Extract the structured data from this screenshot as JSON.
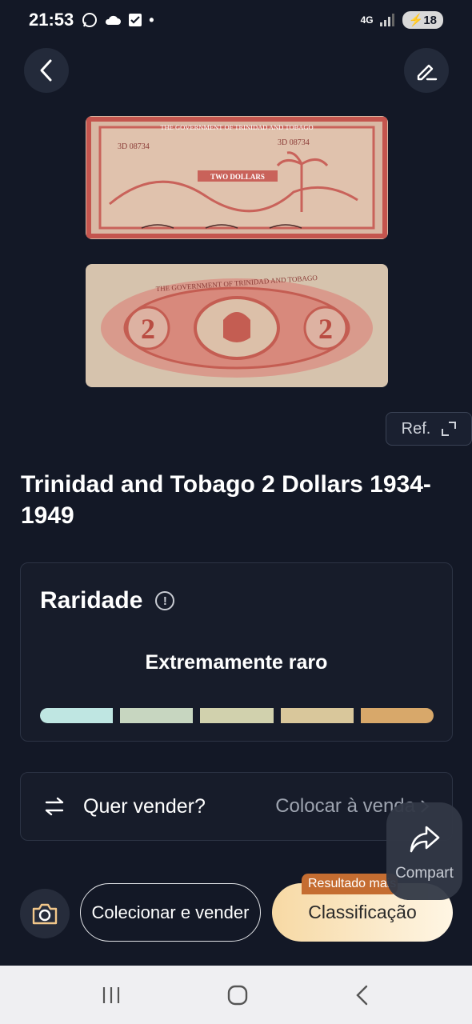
{
  "status_bar": {
    "time": "21:53",
    "dot": "•",
    "network": "4G",
    "battery": "18",
    "icons": [
      "whatsapp-icon",
      "cloud-icon",
      "check-box-icon",
      "signal-icon",
      "battery-icon"
    ]
  },
  "header": {
    "back_icon": "chevron-left-icon",
    "edit_icon": "edit-icon"
  },
  "images": {
    "front_alt": "Banknote front",
    "back_alt": "Banknote back",
    "front_text": {
      "top": "THE GOVERNMENT OF TRINIDAD AND TOBAGO",
      "serial": "3D 08734",
      "denomination": "TWO DOLLARS"
    },
    "back_text": {
      "top": "THE GOVERNMENT OF TRINIDAD AND TOBAGO",
      "numeral": "2"
    }
  },
  "ref_button": {
    "label": "Ref.",
    "icon": "expand-icon"
  },
  "item": {
    "title": "Trinidad and Tobago 2 Dollars 1934-1949"
  },
  "rarity": {
    "heading": "Raridade",
    "icon": "info-icon",
    "level": "Extremamente raro",
    "segments": 5
  },
  "sell": {
    "icon": "swap-icon",
    "label": "Quer vender?",
    "action": "Colocar à venda",
    "action_icon": "chevron-right-icon"
  },
  "share": {
    "label": "Compart",
    "icon": "share-icon"
  },
  "bottom": {
    "camera_icon": "camera-icon",
    "collect_label": "Colecionar e vender",
    "classify_label": "Classificação",
    "classify_badge": "Resultado mais"
  },
  "nav": {
    "recents_icon": "recents-icon",
    "home_icon": "home-icon",
    "back_icon": "back-icon"
  },
  "colors": {
    "background": "#131826",
    "card": "#171c2a",
    "accent": "#f7d9a4",
    "badge": "#c56d31"
  }
}
